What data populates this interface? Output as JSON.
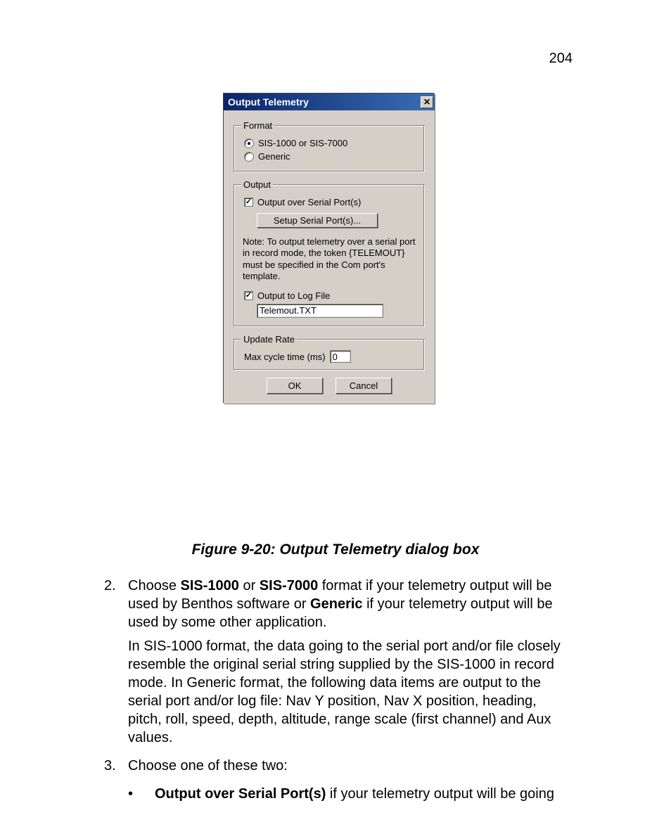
{
  "page_number": "204",
  "dialog": {
    "title": "Output Telemetry",
    "format": {
      "legend": "Format",
      "opt_sis": "SIS-1000 or SIS-7000",
      "opt_generic": "Generic"
    },
    "output": {
      "legend": "Output",
      "chk_serial": "Output over Serial Port(s)",
      "btn_setup": "Setup Serial Port(s)...",
      "note": "Note: To output telemetry over a serial port in record mode, the token {TELEMOUT} must be specified in the Com port's template.",
      "chk_logfile": "Output to Log File",
      "logfile_value": "Telemout.TXT"
    },
    "update_rate": {
      "legend": "Update Rate",
      "label": "Max cycle time (ms)",
      "value": "0"
    },
    "btn_ok": "OK",
    "btn_cancel": "Cancel"
  },
  "caption": "Figure 9-20: Output Telemetry dialog box",
  "text": {
    "item2_num": "2.",
    "item2_a1": "Choose ",
    "item2_b1": "SIS-1000",
    "item2_a2": " or ",
    "item2_b2": "SIS-7000",
    "item2_a3": " format if your telemetry output will be used by Benthos software or ",
    "item2_b3": "Generic",
    "item2_a4": " if your telemetry output will be used by some other application.",
    "item2_p2": "In SIS-1000 format, the data going to the serial port and/or file closely resemble the original serial string supplied by the SIS-1000 in record mode. In Generic format, the following data items are output to the serial port and/or log file: Nav Y position, Nav X position, heading, pitch, roll, speed, depth, altitude, range scale (first channel) and Aux values.",
    "item3_num": "3.",
    "item3_p1": "Choose one of these two:",
    "bullet_mark": "•",
    "bullet_b1": "Output over Serial Port(s)",
    "bullet_a1": " if your telemetry output will be going"
  }
}
